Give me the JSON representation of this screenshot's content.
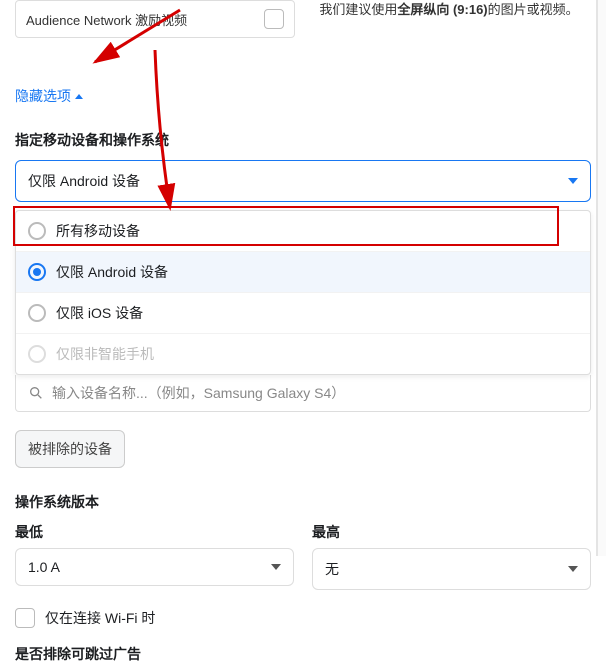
{
  "top": {
    "audience_network_label": "Audience Network 激励视频",
    "recommend_pre": "我们建议使用",
    "recommend_bold": "全屏纵向 (9:16)",
    "recommend_post": "的图片或视频。"
  },
  "hide_options_label": "隐藏选项",
  "device_section_title": "指定移动设备和操作系统",
  "device_select_value": "仅限 Android 设备",
  "device_options": {
    "all": "所有移动设备",
    "android": "仅限 Android 设备",
    "ios": "仅限 iOS 设备",
    "nonsmart": "仅限非智能手机"
  },
  "device_search_placeholder": "输入设备名称...（例如，Samsung Galaxy S4）",
  "excluded_button": "被排除的设备",
  "os_version_title": "操作系统版本",
  "os_min_label": "最低",
  "os_min_value": "1.0 A",
  "os_max_label": "最高",
  "os_max_value": "无",
  "wifi_label": "仅在连接 Wi-Fi 时",
  "skip_ads_title": "是否排除可跳过广告"
}
